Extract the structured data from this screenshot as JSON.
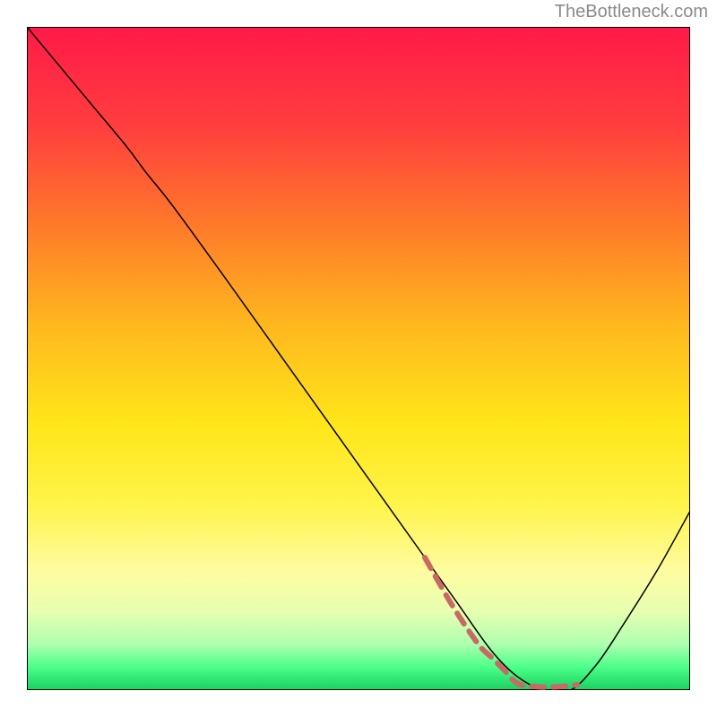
{
  "attribution": "TheBottleneck.com",
  "chart_data": {
    "type": "line",
    "title": "",
    "xlabel": "",
    "ylabel": "",
    "xlim": [
      0,
      100
    ],
    "ylim": [
      0,
      100
    ],
    "background_gradient": {
      "stops": [
        {
          "offset": 0.0,
          "color": "#ff1a48"
        },
        {
          "offset": 0.15,
          "color": "#ff3e3e"
        },
        {
          "offset": 0.3,
          "color": "#ff7a2a"
        },
        {
          "offset": 0.45,
          "color": "#ffb81e"
        },
        {
          "offset": 0.6,
          "color": "#ffe61a"
        },
        {
          "offset": 0.72,
          "color": "#fff44a"
        },
        {
          "offset": 0.82,
          "color": "#fffca0"
        },
        {
          "offset": 0.88,
          "color": "#e8ffb0"
        },
        {
          "offset": 0.93,
          "color": "#b0ffb0"
        },
        {
          "offset": 0.965,
          "color": "#4dff8a"
        },
        {
          "offset": 1.0,
          "color": "#18d060"
        }
      ]
    },
    "series": [
      {
        "name": "bottleneck-curve",
        "color": "#000000",
        "width": 1.5,
        "x": [
          0,
          5,
          10,
          15,
          18,
          22,
          30,
          40,
          50,
          60,
          65,
          70,
          74,
          78,
          82,
          86,
          90,
          95,
          100
        ],
        "y": [
          100,
          94,
          88,
          82,
          78,
          73,
          62,
          48,
          34,
          20,
          13,
          6,
          2,
          0,
          0,
          4,
          10,
          18,
          27
        ]
      },
      {
        "name": "highlight-dashed",
        "color": "#c86a64",
        "width": 6,
        "dash": true,
        "x": [
          60,
          64,
          68,
          70,
          72,
          74,
          77,
          80,
          83
        ],
        "y": [
          20,
          13,
          7,
          5,
          3,
          1,
          0.5,
          0.5,
          0.8
        ]
      }
    ]
  }
}
